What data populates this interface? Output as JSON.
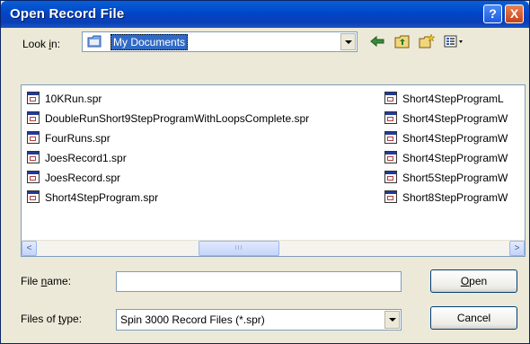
{
  "window": {
    "title": "Open Record File",
    "help_label": "?",
    "close_label": "X"
  },
  "lookin": {
    "label_prefix": "Look ",
    "label_underlined": "i",
    "label_suffix": "n:",
    "value": "My Documents"
  },
  "toolbar": {
    "icons": [
      "back-arrow-icon",
      "up-folder-icon",
      "new-folder-icon",
      "view-menu-icon"
    ]
  },
  "files": {
    "column1": [
      "10KRun.spr",
      "DoubleRunShort9StepProgramWithLoopsComplete.spr",
      "FourRuns.spr",
      "JoesRecord1.spr",
      "JoesRecord.spr",
      "Short4StepProgram.spr"
    ],
    "column2": [
      "Short4StepProgramL",
      "Short4StepProgramW",
      "Short4StepProgramW",
      "Short4StepProgramW",
      "Short5StepProgramW",
      "Short8StepProgramW"
    ],
    "scroll_left_glyph": "<",
    "scroll_right_glyph": ">",
    "thumb_grip": "III"
  },
  "filename": {
    "label_prefix": "File ",
    "label_underlined": "n",
    "label_suffix": "ame:",
    "value": ""
  },
  "filetype": {
    "label_prefix": "Files of ",
    "label_underlined": "t",
    "label_suffix": "ype:",
    "value": "Spin 3000 Record Files (*.spr)"
  },
  "buttons": {
    "open_underlined": "O",
    "open_rest": "pen",
    "cancel": "Cancel"
  },
  "colors": {
    "titlebar": "#0a4fd0",
    "dialog_bg": "#ece9d8",
    "selection": "#316ac5",
    "close": "#c5421c"
  }
}
